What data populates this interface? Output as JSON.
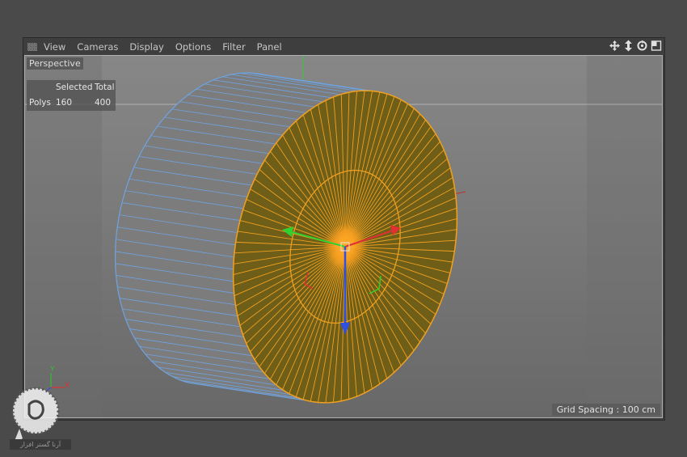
{
  "menu": {
    "items": [
      "View",
      "Cameras",
      "Display",
      "Options",
      "Filter",
      "Panel"
    ]
  },
  "nav_icons": [
    "move-view-icon",
    "dolly-view-icon",
    "rotate-view-icon",
    "maximize-view-icon"
  ],
  "viewport": {
    "label": "Perspective",
    "grid_spacing": "Grid Spacing : 100 cm"
  },
  "hud": {
    "col_selected": "Selected",
    "col_total": "Total",
    "row_label": "Polys",
    "selected_value": "160",
    "total_value": "400"
  },
  "axes": {
    "y": "Y",
    "x": "X"
  },
  "colors": {
    "selection": "#f0a020",
    "wire_edges": "#6fa3e0",
    "axis_x": "#e03030",
    "axis_y": "#30c030",
    "axis_z": "#3050e0"
  },
  "watermark": {
    "text": "آرنا گستر افزار"
  }
}
